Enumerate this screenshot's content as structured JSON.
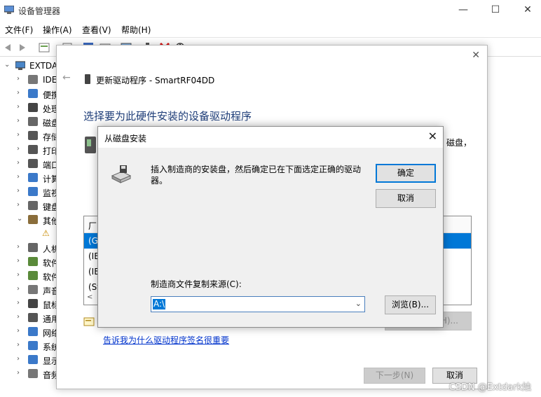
{
  "app": {
    "title": "设备管理器",
    "window_controls": {
      "minimize": "—",
      "maximize": "☐",
      "close": "✕"
    }
  },
  "menu": {
    "file": "文件(F)",
    "action": "操作(A)",
    "view": "查看(V)",
    "help": "帮助(H)"
  },
  "toolbar": [
    "back-icon",
    "forward-icon",
    "properties-icon",
    "doc-icon",
    "help-icon",
    "view-icon",
    "monitor-icon",
    "update-driver-icon",
    "uninstall-icon",
    "scan-icon"
  ],
  "tree": {
    "root": "EXTDA",
    "items": [
      {
        "label": "IDE",
        "icon": "ide-icon"
      },
      {
        "label": "便携",
        "icon": "portable-icon"
      },
      {
        "label": "处理",
        "icon": "cpu-icon"
      },
      {
        "label": "磁盘",
        "icon": "disk-icon"
      },
      {
        "label": "存储",
        "icon": "storage-icon"
      },
      {
        "label": "打印",
        "icon": "printer-icon"
      },
      {
        "label": "端口",
        "icon": "port-icon"
      },
      {
        "label": "计算",
        "icon": "computer-icon"
      },
      {
        "label": "监视",
        "icon": "monitor-icon"
      },
      {
        "label": "键盘",
        "icon": "keyboard-icon"
      },
      {
        "label": "其他",
        "icon": "other-icon"
      },
      {
        "label": "人机",
        "icon": "hid-icon"
      },
      {
        "label": "软件",
        "icon": "software-icon"
      },
      {
        "label": "软件",
        "icon": "software-icon"
      },
      {
        "label": "声音",
        "icon": "sound-icon"
      },
      {
        "label": "鼠标",
        "icon": "mouse-icon"
      },
      {
        "label": "通用",
        "icon": "usb-icon"
      },
      {
        "label": "网络",
        "icon": "network-icon"
      },
      {
        "label": "系统",
        "icon": "system-icon"
      },
      {
        "label": "显示",
        "icon": "display-icon"
      },
      {
        "label": "音频",
        "icon": "audio-icon"
      }
    ]
  },
  "wizard": {
    "header": "更新驱动程序 - SmartRF04DD",
    "heading": "选择要为此硬件安装的设备驱动程序",
    "right_text": "磁盘，",
    "list_header": "厂",
    "list_rows": [
      "(G",
      "(IE",
      "(IE",
      "(St"
    ],
    "have_disk_partial": "H)...",
    "link": "告诉我为什么驱动程序签名很重要",
    "next": "下一步(N)",
    "cancel": "取消"
  },
  "disk_dialog": {
    "title": "从磁盘安装",
    "message": "插入制造商的安装盘，然后确定已在下面选定正确的驱动器。",
    "ok": "确定",
    "cancel": "取消",
    "source_label": "制造商文件复制来源(C):",
    "source_value": "A:\\",
    "browse": "浏览(B)..."
  },
  "watermark": "CSDN @Extdark烛"
}
